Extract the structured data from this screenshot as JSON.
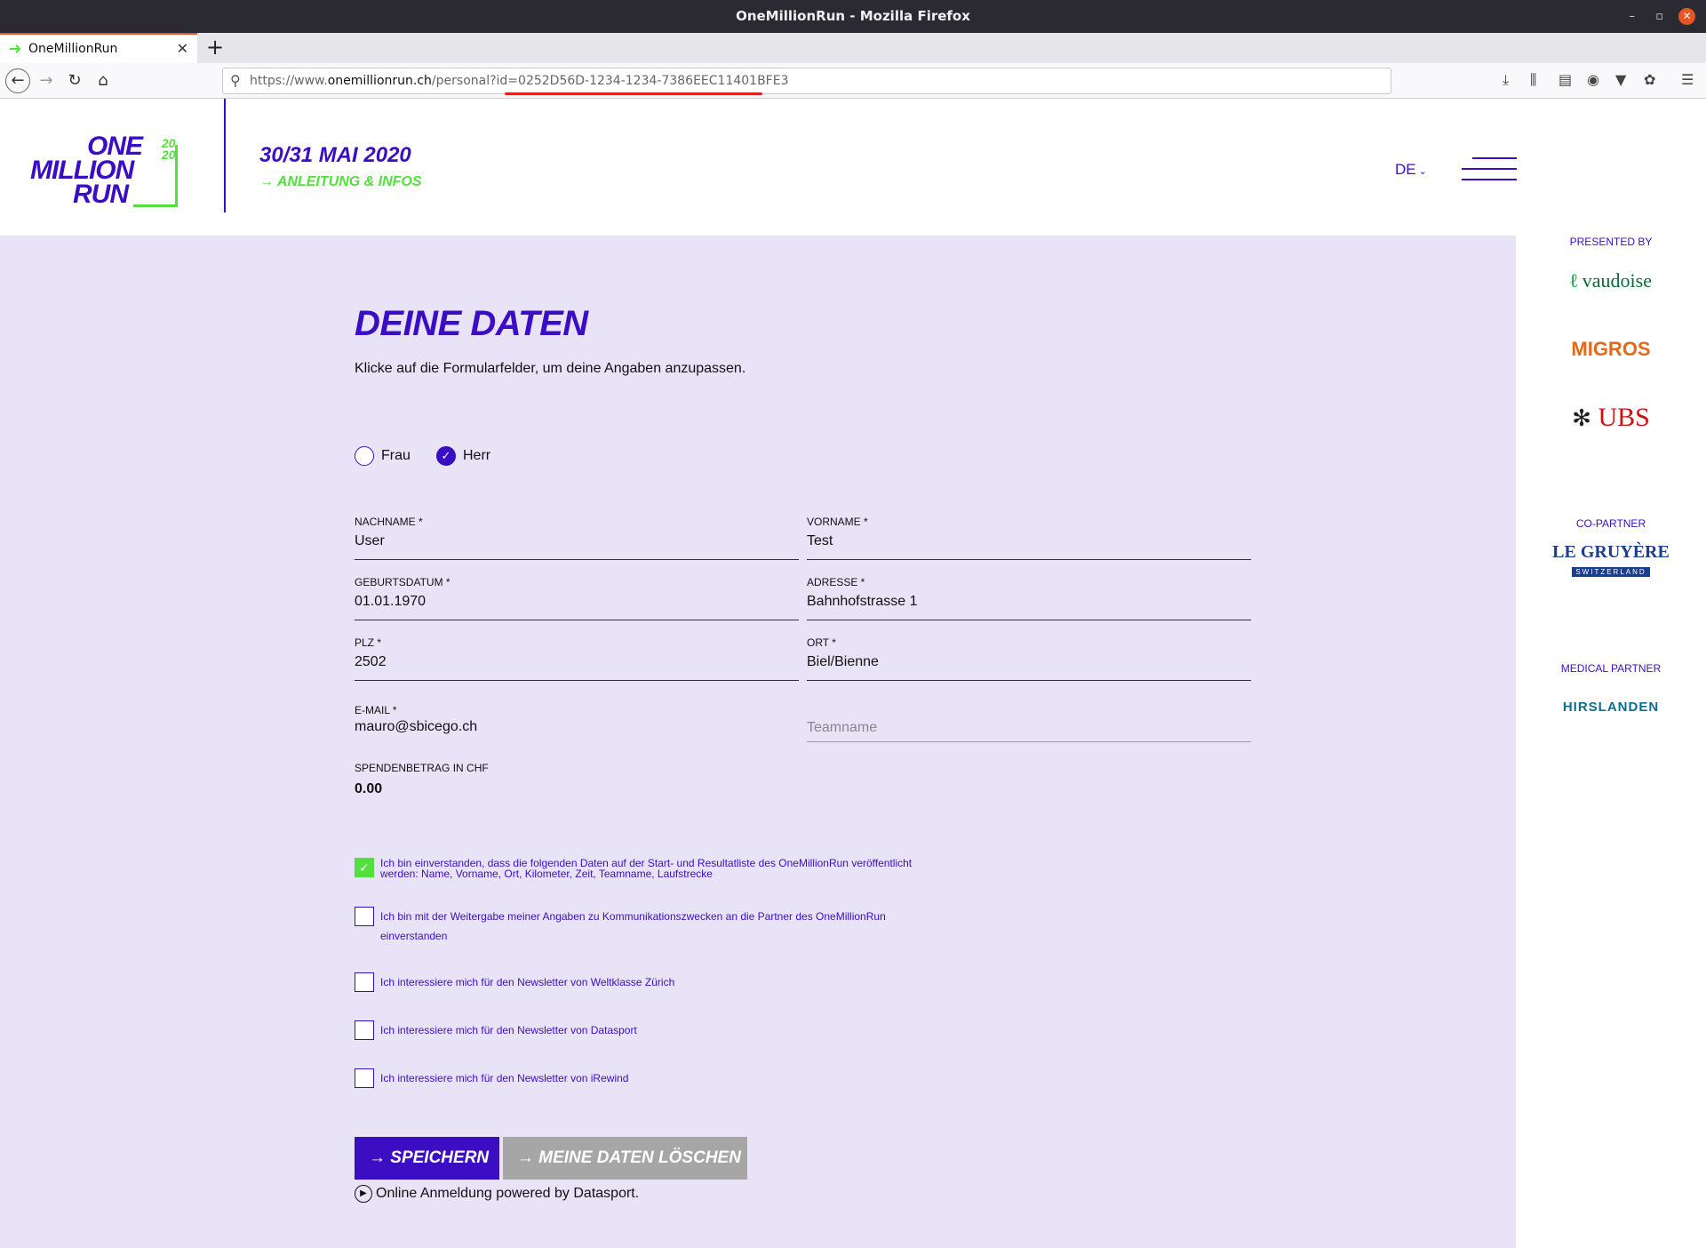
{
  "window": {
    "title": "OneMillionRun - Mozilla Firefox"
  },
  "browser": {
    "tab_title": "OneMillionRun",
    "url_prefix": "https://www.",
    "url_host": "onemillionrun.ch",
    "url_path": "/personal?id=0252D56D-1234-1234-7386EEC11401BFE3"
  },
  "header": {
    "logo_line1": "ONE",
    "logo_line2": "MILLION",
    "logo_line3": "RUN",
    "logo_year1": "20",
    "logo_year2": "20",
    "event_date": "30/31 MAI 2020",
    "event_link": "ANLEITUNG & INFOS",
    "language": "DE"
  },
  "form": {
    "title": "DEINE DATEN",
    "subtitle": "Klicke auf die Formularfelder, um deine Angaben anzupassen.",
    "salutation": {
      "frau": "Frau",
      "herr": "Herr",
      "selected": "Herr"
    },
    "fields": {
      "nachname": {
        "label": "NACHNAME *",
        "value": "User"
      },
      "vorname": {
        "label": "VORNAME *",
        "value": "Test"
      },
      "geburtsdatum": {
        "label": "GEBURTSDATUM *",
        "value": "01.01.1970"
      },
      "adresse": {
        "label": "ADRESSE *",
        "value": "Bahnhofstrasse 1"
      },
      "plz": {
        "label": "PLZ *",
        "value": "2502"
      },
      "ort": {
        "label": "ORT *",
        "value": "Biel/Bienne"
      },
      "email": {
        "label": "E-MAIL *",
        "value": "mauro@sbicego.ch"
      },
      "teamname": {
        "placeholder": "Teamname"
      }
    },
    "donation": {
      "label": "SPENDENBETRAG IN CHF",
      "value": "0.00"
    },
    "consents": [
      {
        "line1": "Ich bin einverstanden, dass die folgenden Daten auf der Start- und Resultatliste des OneMillionRun veröffentlicht",
        "line2": "werden: Name, Vorname, Ort, Kilometer, Zeit, Teamname, Laufstrecke",
        "checked": true
      },
      {
        "line1": "Ich bin mit der Weitergabe meiner Angaben zu Kommunikationszwecken an die Partner des OneMillionRun",
        "line2": "einverstanden",
        "checked": false
      },
      {
        "line1": "Ich interessiere mich für den Newsletter von Weltklasse Zürich",
        "checked": false
      },
      {
        "line1": "Ich interessiere mich für den Newsletter von Datasport",
        "checked": false
      },
      {
        "line1": "Ich interessiere mich für den Newsletter von iRewind",
        "checked": false
      }
    ],
    "save_label": "SPEICHERN",
    "delete_label": "MEINE DATEN LÖSCHEN",
    "powered_by": "Online Anmeldung powered by Datasport."
  },
  "sponsors": {
    "presented_by": "PRESENTED BY",
    "main": [
      "vaudoise",
      "MIGROS",
      "UBS"
    ],
    "co_partner_label": "CO-PARTNER",
    "co_partner_line1": "LE GRUYÈRE",
    "co_partner_line2": "SWITZERLAND",
    "medical_label": "MEDICAL PARTNER",
    "medical": "HIRSLANDEN"
  },
  "colors": {
    "brand": "#3b0ec4",
    "accent": "#52e13c",
    "background": "#e8e3f7"
  }
}
